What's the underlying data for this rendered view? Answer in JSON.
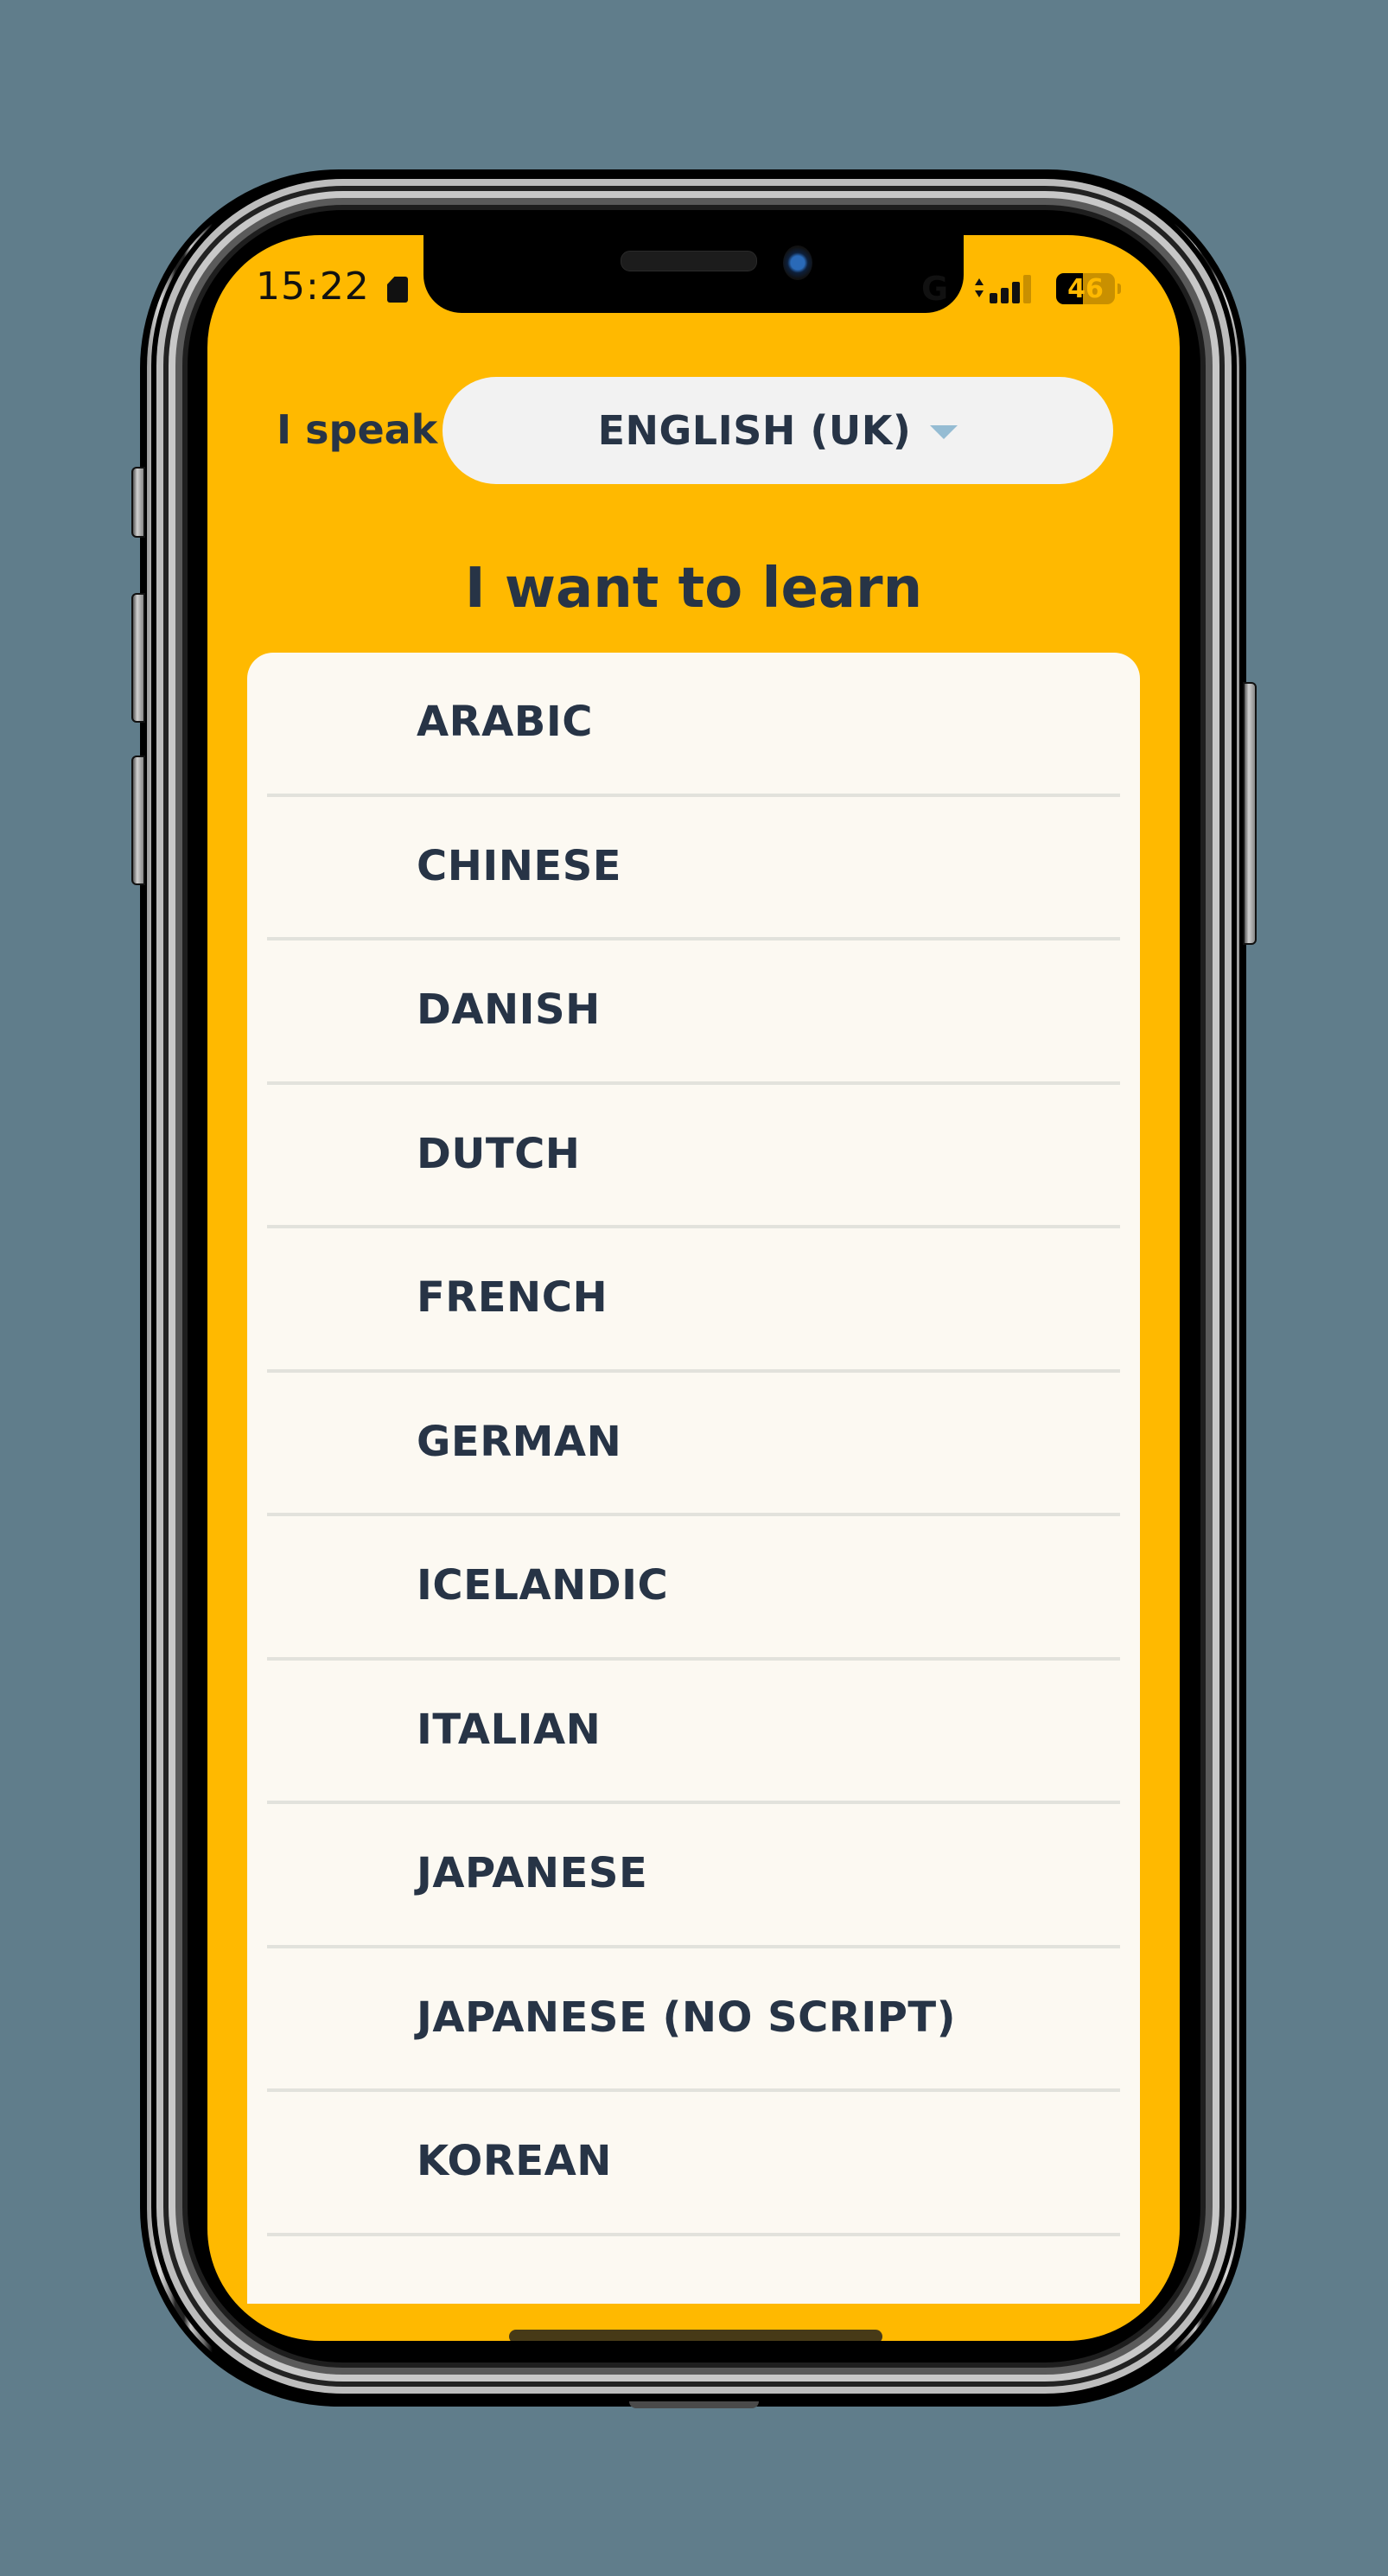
{
  "status_bar": {
    "time": "15:22",
    "storage_icon": "sd-card-icon",
    "network_type": "G",
    "signal_bars_total": 4,
    "signal_bars_active": 3,
    "battery_percent": 46,
    "battery_label": "46"
  },
  "header": {
    "speak_label": "I speak",
    "native_language": {
      "selected": "ENGLISH (UK)",
      "icon": "caret-down-icon"
    },
    "learn_title": "I want to learn"
  },
  "languages": [
    {
      "label": "ARABIC"
    },
    {
      "label": "CHINESE"
    },
    {
      "label": "DANISH"
    },
    {
      "label": "DUTCH"
    },
    {
      "label": "FRENCH"
    },
    {
      "label": "GERMAN"
    },
    {
      "label": "ICELANDIC"
    },
    {
      "label": "ITALIAN"
    },
    {
      "label": "JAPANESE"
    },
    {
      "label": "JAPANESE (NO SCRIPT)"
    },
    {
      "label": "KOREAN"
    },
    {
      "label": ""
    }
  ],
  "colors": {
    "background": "#607d8b",
    "screen_accent": "#ffb900",
    "card": "#fcf9f2",
    "text": "#273446",
    "select_bg": "#f2f2f2",
    "caret": "#95bcd3",
    "divider": "#e2e2dc"
  }
}
